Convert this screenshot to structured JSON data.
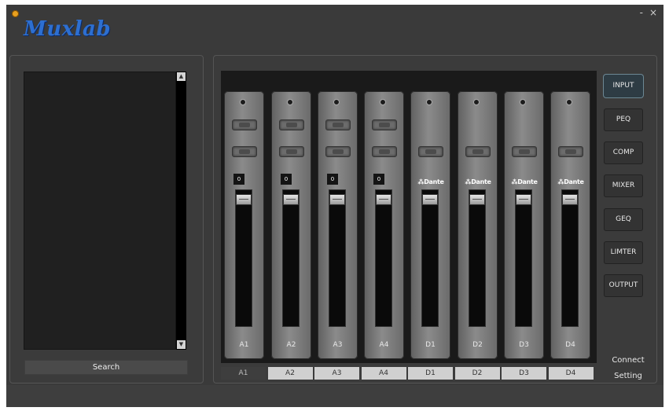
{
  "app": {
    "logo": "Muxlab",
    "window_controls": {
      "minimize": "-",
      "close": "×"
    }
  },
  "left_panel": {
    "search_label": "Search",
    "scroll_up_icon": "▲",
    "scroll_down_icon": "▼"
  },
  "channels": [
    {
      "label": "A1",
      "type": "analog",
      "gain": "0"
    },
    {
      "label": "A2",
      "type": "analog",
      "gain": "0"
    },
    {
      "label": "A3",
      "type": "analog",
      "gain": "0"
    },
    {
      "label": "A4",
      "type": "analog",
      "gain": "0"
    },
    {
      "label": "D1",
      "type": "dante",
      "dante_label": "⁂Dante"
    },
    {
      "label": "D2",
      "type": "dante",
      "dante_label": "⁂Dante"
    },
    {
      "label": "D3",
      "type": "dante",
      "dante_label": "⁂Dante"
    },
    {
      "label": "D4",
      "type": "dante",
      "dante_label": "⁂Dante"
    }
  ],
  "channel_select": [
    "A1",
    "A2",
    "A3",
    "A4",
    "D1",
    "D2",
    "D3",
    "D4"
  ],
  "channel_select_active": "A1",
  "side_menu": [
    {
      "label": "INPUT",
      "active": true
    },
    {
      "label": "PEQ"
    },
    {
      "label": "COMP"
    },
    {
      "label": "MIXER"
    },
    {
      "label": "GEQ"
    },
    {
      "label": "LIMTER"
    },
    {
      "label": "OUTPUT"
    }
  ],
  "connect": {
    "line1": "Connect",
    "line2": "Setting"
  },
  "colors": {
    "logo": "#2d6fd1",
    "background": "#3a3a3a",
    "active_tab_border": "#6d8894"
  }
}
